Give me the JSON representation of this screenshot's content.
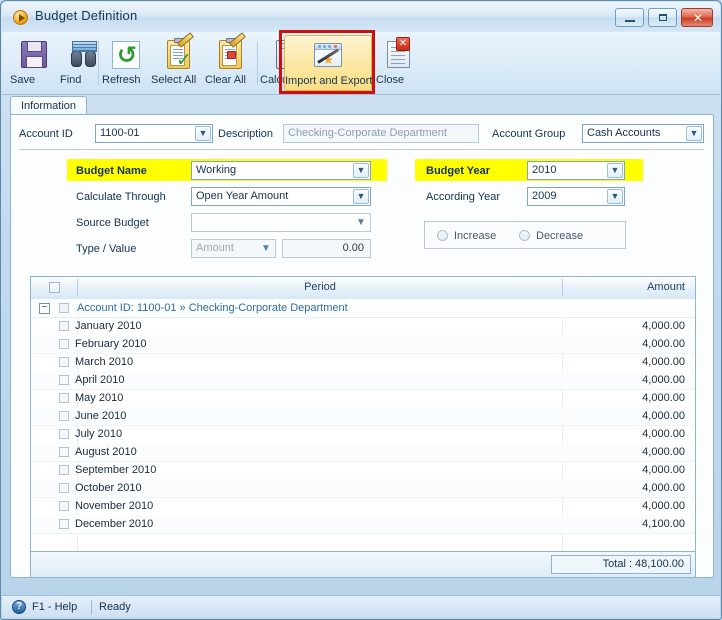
{
  "window": {
    "title": "Budget Definition",
    "title_icon": "play-circle-icon",
    "minimize_label": "–",
    "maximize_label": "",
    "close_label": "✕"
  },
  "toolbar": {
    "items": [
      {
        "label": "Save",
        "icon": "floppy-disk-icon"
      },
      {
        "label": "Find",
        "icon": "binoculars-icon"
      },
      {
        "label": "Refresh",
        "icon": "refresh-arrows-icon"
      },
      {
        "label": "Select All",
        "icon": "clipboard-check-icon"
      },
      {
        "label": "Clear All",
        "icon": "clipboard-eraser-icon"
      },
      {
        "label": "Calculate",
        "icon": "calculator-icon"
      },
      {
        "label": "Import and Export",
        "icon": "wand-window-icon"
      },
      {
        "label": "Close",
        "icon": "document-close-icon"
      }
    ],
    "highlighted_item": "Import and Export",
    "annotation_color": "#cc1010"
  },
  "tabs": [
    {
      "label": "Information",
      "selected": true
    }
  ],
  "form": {
    "account_id": {
      "label": "Account ID",
      "value": "1100-01"
    },
    "description": {
      "label": "Description",
      "value": "Checking-Corporate Department"
    },
    "account_group": {
      "label": "Account Group",
      "value": "Cash Accounts"
    },
    "budget_name": {
      "label": "Budget Name",
      "value": "Working",
      "highlight": "#ffff00"
    },
    "calculate_through": {
      "label": "Calculate Through",
      "value": "Open Year Amount"
    },
    "source_budget": {
      "label": "Source Budget",
      "value": ""
    },
    "type_value": {
      "label": "Type / Value",
      "type": "Amount",
      "value": "0.00"
    },
    "budget_year": {
      "label": "Budget Year",
      "value": "2010",
      "highlight": "#ffff00"
    },
    "according_year": {
      "label": "According Year",
      "value": "2009"
    },
    "adjust": {
      "increase_label": "Increase",
      "decrease_label": "Decrease",
      "selected": ""
    }
  },
  "grid": {
    "columns": [
      "Period",
      "Amount"
    ],
    "group_row": "Account ID: 1100-01 » Checking-Corporate Department",
    "rows": [
      {
        "period": "January 2010",
        "amount": "4,000.00"
      },
      {
        "period": "February 2010",
        "amount": "4,000.00"
      },
      {
        "period": "March 2010",
        "amount": "4,000.00"
      },
      {
        "period": "April 2010",
        "amount": "4,000.00"
      },
      {
        "period": "May 2010",
        "amount": "4,000.00"
      },
      {
        "period": "June 2010",
        "amount": "4,000.00"
      },
      {
        "period": "July 2010",
        "amount": "4,000.00"
      },
      {
        "period": "August 2010",
        "amount": "4,000.00"
      },
      {
        "period": "September 2010",
        "amount": "4,000.00"
      },
      {
        "period": "October 2010",
        "amount": "4,000.00"
      },
      {
        "period": "November 2010",
        "amount": "4,000.00"
      },
      {
        "period": "December 2010",
        "amount": "4,100.00"
      }
    ],
    "total": "Total : 48,100.00"
  },
  "statusbar": {
    "help": "F1 - Help",
    "status": "Ready"
  }
}
